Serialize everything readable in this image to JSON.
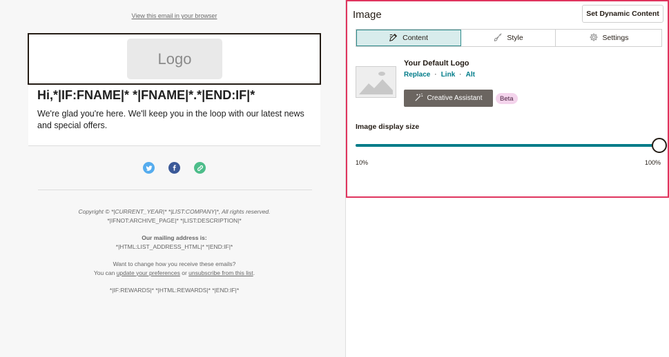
{
  "preview": {
    "view_in_browser": "View this email in your browser",
    "logo_text": "Logo",
    "greeting": "Hi,*|IF:FNAME|* *|FNAME|*.*|END:IF|*",
    "intro": "We're glad you're here. We'll keep you in the loop with our latest news and special offers.",
    "social": [
      "twitter-icon",
      "facebook-icon",
      "link-icon"
    ],
    "footer": {
      "copyright": "Copyright © *|CURRENT_YEAR|* *|LIST:COMPANY|*, All rights reserved.",
      "description": "*|IFNOT:ARCHIVE_PAGE|* *|LIST:DESCRIPTION|*",
      "mailing_heading": "Our mailing address is:",
      "mailing_value": "*|HTML:LIST_ADDRESS_HTML|* *|END:IF|*",
      "change_question": "Want to change how you receive these emails?",
      "you_can": "You can ",
      "update_prefs": "update your preferences",
      "or": " or ",
      "unsubscribe": "unsubscribe from this list",
      "period": ".",
      "rewards": "*|IF:REWARDS|* *|HTML:REWARDS|* *|END:IF|*"
    }
  },
  "panel": {
    "title": "Image",
    "dynamic_button": "Set Dynamic Content",
    "tabs": [
      {
        "label": "Content",
        "icon": "edit-icon",
        "active": true
      },
      {
        "label": "Style",
        "icon": "brush-icon",
        "active": false
      },
      {
        "label": "Settings",
        "icon": "gear-icon",
        "active": false
      }
    ],
    "logo_name": "Your Default Logo",
    "links": {
      "replace": "Replace",
      "link": "Link",
      "alt": "Alt",
      "separator": "·"
    },
    "creative_assistant": "Creative Assistant",
    "beta": "Beta",
    "size_label": "Image display size",
    "slider": {
      "min_label": "10%",
      "max_label": "100%",
      "value_percent": 100
    }
  },
  "colors": {
    "accent_teal": "#007c89",
    "selection_border": "#e0345e",
    "active_tab_bg": "#d8ecec"
  }
}
